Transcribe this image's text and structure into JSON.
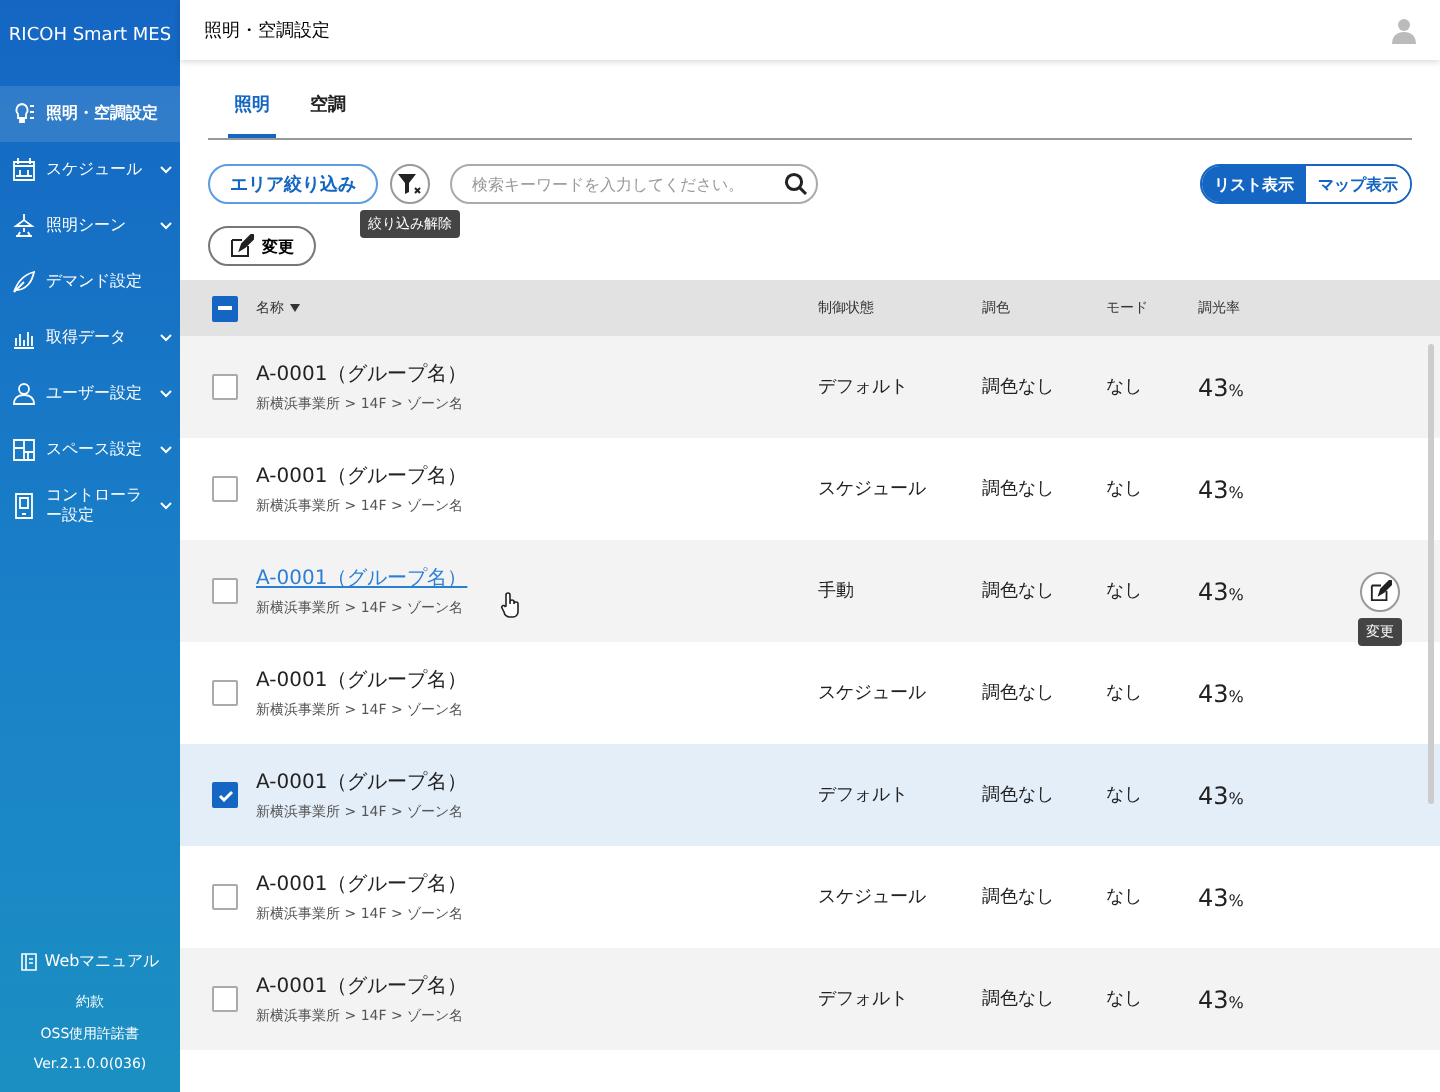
{
  "sidebar": {
    "brand": "RICOH Smart MES",
    "items": [
      {
        "label": "照明・空調設定",
        "expandable": false,
        "selected": true
      },
      {
        "label": "スケジュール",
        "expandable": true,
        "selected": false
      },
      {
        "label": "照明シーン",
        "expandable": true,
        "selected": false
      },
      {
        "label": "デマンド設定",
        "expandable": false,
        "selected": false
      },
      {
        "label": "取得データ",
        "expandable": true,
        "selected": false
      },
      {
        "label": "ユーザー設定",
        "expandable": true,
        "selected": false
      },
      {
        "label": "スペース設定",
        "expandable": true,
        "selected": false
      },
      {
        "label": "コントローラー設定",
        "expandable": true,
        "selected": false
      }
    ],
    "manual": "Webマニュアル",
    "links": [
      "約款",
      "OSS使用許諾書"
    ],
    "version": "Ver.2.1.0.0(036)"
  },
  "header": {
    "title": "照明・空調設定"
  },
  "tabs": [
    {
      "label": "照明",
      "selected": true
    },
    {
      "label": "空調",
      "selected": false
    }
  ],
  "toolbar": {
    "area_filter": "エリア絞り込み",
    "clear_tooltip": "絞り込み解除",
    "search": {
      "placeholder": "検索キーワードを入力してください。"
    },
    "views": [
      {
        "label": "リスト表示",
        "selected": true
      },
      {
        "label": "マップ表示",
        "selected": false
      }
    ],
    "edit": "変更"
  },
  "table": {
    "columns": [
      "名称",
      "制御状態",
      "調色",
      "モード",
      "調光率"
    ],
    "select_all_partial": true,
    "edit_tooltip": "変更",
    "rows": [
      {
        "name": "A-0001（グループ名）",
        "path": "新横浜事業所 > 14F > ゾーン名",
        "status": "デフォルト",
        "color_tone": "調色なし",
        "mode": "なし",
        "dimming": "43",
        "unit": "%",
        "checked": false,
        "hovered": false
      },
      {
        "name": "A-0001（グループ名）",
        "path": "新横浜事業所 > 14F > ゾーン名",
        "status": "スケジュール",
        "color_tone": "調色なし",
        "mode": "なし",
        "dimming": "43",
        "unit": "%",
        "checked": false,
        "hovered": false
      },
      {
        "name": "A-0001（グループ名）",
        "path": "新横浜事業所 > 14F > ゾーン名",
        "status": "手動",
        "color_tone": "調色なし",
        "mode": "なし",
        "dimming": "43",
        "unit": "%",
        "checked": false,
        "hovered": true
      },
      {
        "name": "A-0001（グループ名）",
        "path": "新横浜事業所 > 14F > ゾーン名",
        "status": "スケジュール",
        "color_tone": "調色なし",
        "mode": "なし",
        "dimming": "43",
        "unit": "%",
        "checked": false,
        "hovered": false
      },
      {
        "name": "A-0001（グループ名）",
        "path": "新横浜事業所 > 14F > ゾーン名",
        "status": "デフォルト",
        "color_tone": "調色なし",
        "mode": "なし",
        "dimming": "43",
        "unit": "%",
        "checked": true,
        "hovered": false
      },
      {
        "name": "A-0001（グループ名）",
        "path": "新横浜事業所 > 14F > ゾーン名",
        "status": "スケジュール",
        "color_tone": "調色なし",
        "mode": "なし",
        "dimming": "43",
        "unit": "%",
        "checked": false,
        "hovered": false
      },
      {
        "name": "A-0001（グループ名）",
        "path": "新横浜事業所 > 14F > ゾーン名",
        "status": "デフォルト",
        "color_tone": "調色なし",
        "mode": "なし",
        "dimming": "43",
        "unit": "%",
        "checked": false,
        "hovered": false
      }
    ]
  }
}
